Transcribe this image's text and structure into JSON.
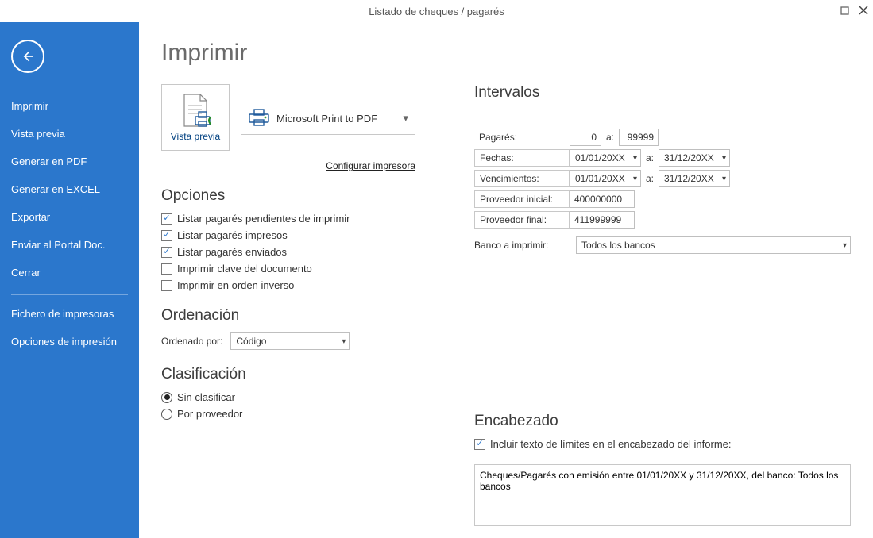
{
  "window_title": "Listado de cheques / pagarés",
  "page_title": "Imprimir",
  "sidebar": {
    "items": [
      "Imprimir",
      "Vista previa",
      "Generar en PDF",
      "Generar en EXCEL",
      "Exportar",
      "Enviar al Portal Doc.",
      "Cerrar"
    ],
    "items2": [
      "Fichero de impresoras",
      "Opciones de impresión"
    ]
  },
  "preview_button_label": "Vista previa",
  "printer_name": "Microsoft Print to PDF",
  "configure_printer": "Configurar impresora",
  "options_heading": "Opciones",
  "options": {
    "pendientes": {
      "label": "Listar pagarés pendientes de imprimir",
      "checked": true
    },
    "impresos": {
      "label": "Listar pagarés impresos",
      "checked": true
    },
    "enviados": {
      "label": "Listar pagarés enviados",
      "checked": true
    },
    "clave": {
      "label": "Imprimir clave del documento",
      "checked": false
    },
    "inverso": {
      "label": "Imprimir en orden inverso",
      "checked": false
    }
  },
  "order_heading": "Ordenación",
  "order_label": "Ordenado por:",
  "order_value": "Código",
  "class_heading": "Clasificación",
  "class_options": {
    "sin": {
      "label": "Sin clasificar",
      "selected": true
    },
    "prov": {
      "label": "Por proveedor",
      "selected": false
    }
  },
  "intervals_heading": "Intervalos",
  "intervals": {
    "pagares_label": "Pagarés:",
    "pagares_from": "0",
    "pagares_to": "99999",
    "fechas_label": "Fechas:",
    "fechas_from": "01/01/20XX",
    "fechas_to": "31/12/20XX",
    "venc_label": "Vencimientos:",
    "venc_from": "01/01/20XX",
    "venc_to": "31/12/20XX",
    "prov_ini_label": "Proveedor inicial:",
    "prov_ini_val": "400000000",
    "prov_fin_label": "Proveedor final:",
    "prov_fin_val": "411999999",
    "a": "a:",
    "bank_label": "Banco a imprimir:",
    "bank_value": "Todos los bancos"
  },
  "header_heading": "Encabezado",
  "header_include_label": "Incluir texto de límites en el encabezado del informe:",
  "header_text": "Cheques/Pagarés con emisión entre 01/01/20XX y 31/12/20XX, del banco: Todos los bancos"
}
